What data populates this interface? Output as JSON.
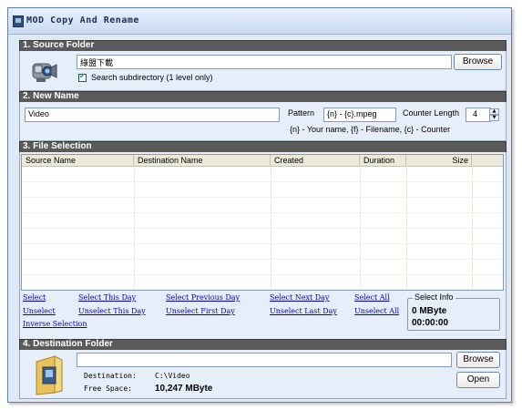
{
  "window": {
    "title": "MOD Copy And Rename"
  },
  "source": {
    "section_title": "1. Source Folder",
    "path_value": "綠盟下載",
    "browse_label": "Browse",
    "subdir_label": "Search subdirectory (1 level only)",
    "subdir_checked": true
  },
  "newname": {
    "section_title": "2. New Name",
    "name_value": "Video",
    "pattern_label": "Pattern",
    "pattern_value": "{n} - {c}.mpeg",
    "counter_label": "Counter Length",
    "counter_value": "4",
    "hint": "{n} - Your name, {f} - Filename, {c} - Counter"
  },
  "files": {
    "section_title": "3. File Selection",
    "columns": [
      "Source Name",
      "Destination Name",
      "Created",
      "Duration",
      "Size"
    ],
    "rows": [],
    "links": {
      "select": "Select",
      "select_this_day": "Select This Day",
      "select_previous_day": "Select Previous Day",
      "select_next_day": "Select Next Day",
      "select_all": "Select All",
      "unselect": "Unselect",
      "unselect_this_day": "Unselect This Day",
      "unselect_first_day": "Unselect First Day",
      "unselect_last_day": "Unselect Last Day",
      "unselect_all": "Unselect All",
      "inverse_selection": "Inverse Selection"
    },
    "select_info": {
      "title": "Select Info",
      "size": "0 MByte",
      "duration": "00:00:00"
    }
  },
  "destination": {
    "section_title": "4. Destination Folder",
    "path_value": "",
    "browse_label": "Browse",
    "open_label": "Open",
    "destination_label": "Destination:",
    "destination_value": "C:\\Video",
    "free_space_label": "Free Space:",
    "free_space_value": "10,247 MByte"
  }
}
